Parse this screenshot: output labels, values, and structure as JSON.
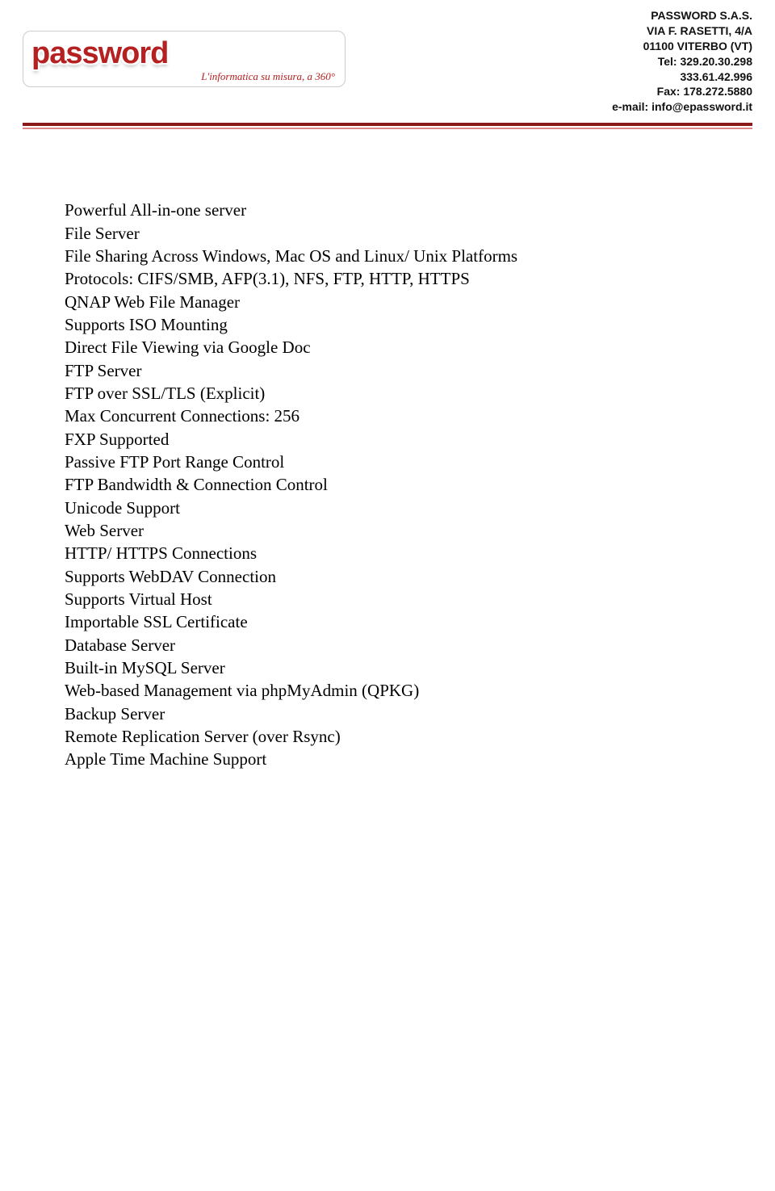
{
  "company": {
    "name": "PASSWORD S.A.S.",
    "address1": "VIA F. RASETTI, 4/A",
    "address2": "01100 VITERBO (VT)",
    "tel1": "Tel: 329.20.30.298",
    "tel2": "333.61.42.996",
    "fax": "Fax: 178.272.5880",
    "email": "e-mail: info@epassword.it"
  },
  "logo": {
    "word": "password",
    "tagline": "L'informatica su misura, a 360°"
  },
  "headline": "Powerful All-in-one server",
  "sections": {
    "file_server": {
      "title": "File Server",
      "lines": [
        "File Sharing Across Windows, Mac OS and Linux/ Unix Platforms",
        "Protocols: CIFS/SMB, AFP(3.1), NFS, FTP, HTTP, HTTPS",
        "QNAP Web File Manager",
        "Supports ISO Mounting",
        "Direct File Viewing via Google Doc"
      ]
    },
    "ftp_server": {
      "title": "FTP Server",
      "lines": [
        "FTP over SSL/TLS (Explicit)",
        "Max Concurrent Connections: 256",
        "FXP Supported",
        "Passive FTP Port Range Control",
        "FTP Bandwidth & Connection Control",
        "Unicode Support"
      ]
    },
    "web_server": {
      "title": "Web Server",
      "lines": [
        "HTTP/ HTTPS Connections",
        "Supports WebDAV Connection",
        "Supports Virtual Host",
        "Importable SSL Certificate"
      ]
    },
    "db_server": {
      "title": "Database Server",
      "lines": [
        "Built-in MySQL Server",
        "Web-based Management via phpMyAdmin (QPKG)"
      ]
    },
    "backup_server": {
      "title": "Backup Server",
      "lines": [
        "Remote Replication Server (over Rsync)",
        "Apple Time Machine Support"
      ]
    }
  }
}
